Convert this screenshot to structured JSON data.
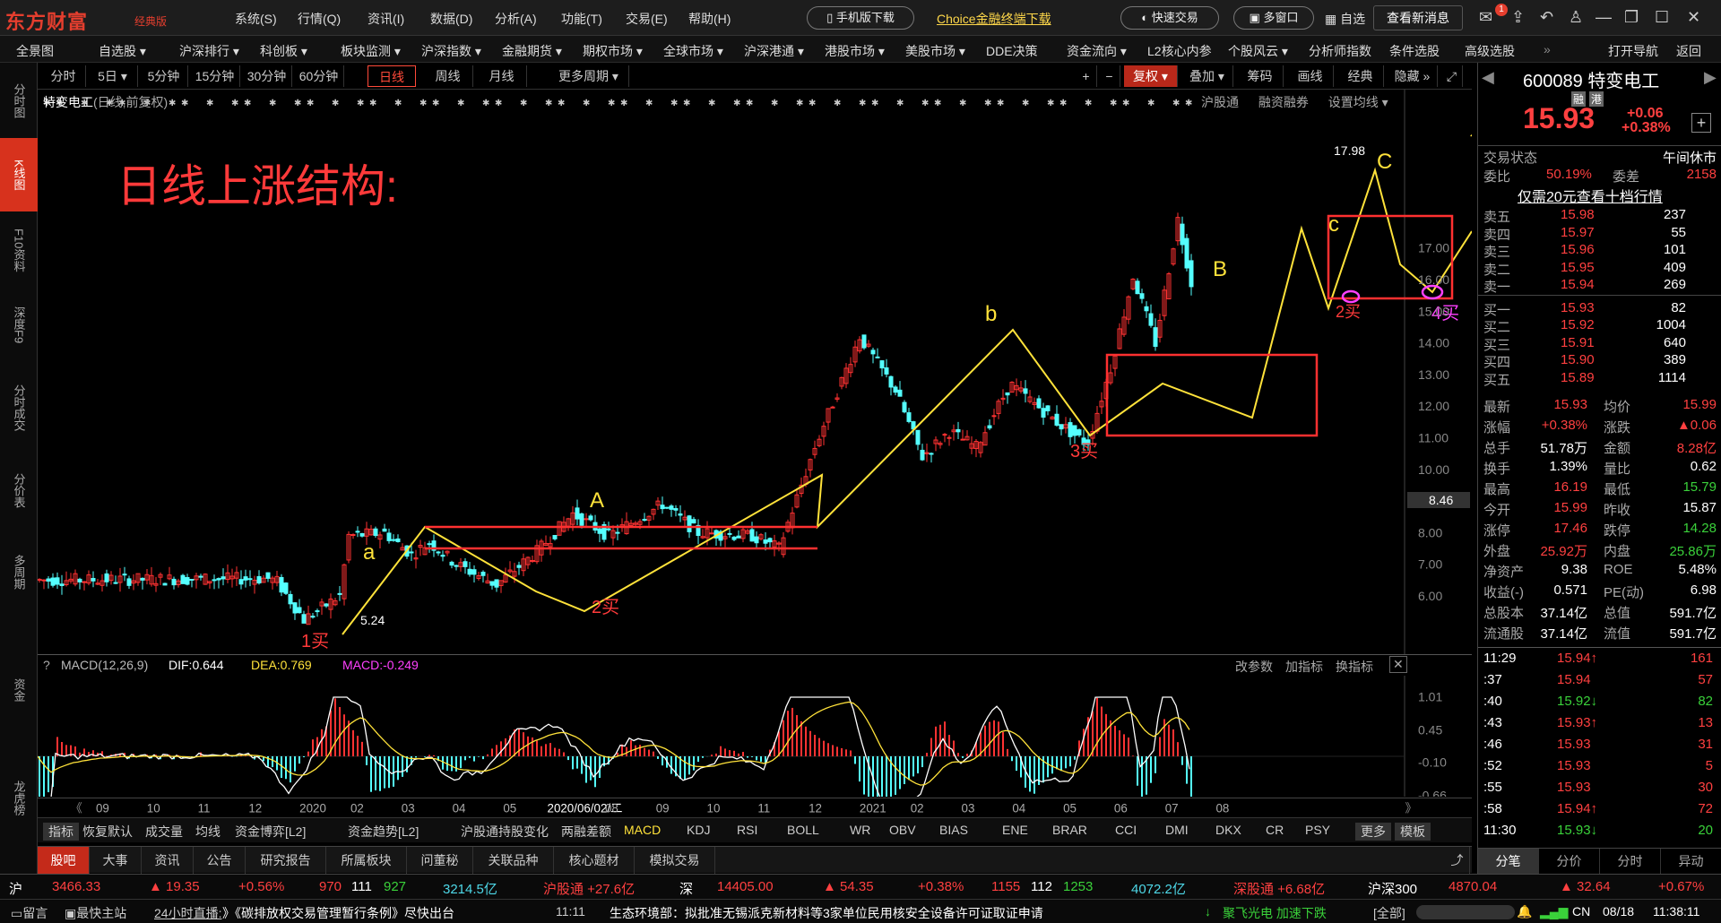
{
  "app": {
    "logo": "东方财富",
    "edition": "经典版"
  },
  "menu": [
    "系统(S)",
    "行情(Q)",
    "资讯(I)",
    "数据(D)",
    "分析(A)",
    "功能(T)",
    "交易(E)",
    "帮助(H)"
  ],
  "top_actions": {
    "mobile": "手机版下载",
    "choice": "Choice金融终端下载",
    "quick_trade": "快速交易",
    "multi_window": "多窗口",
    "self": "自选",
    "new_msg": "查看新消息",
    "msg_count": "1"
  },
  "nav": [
    "全景图",
    "自选股 ▾",
    "沪深排行 ▾",
    "科创板 ▾",
    "板块监测 ▾",
    "沪深指数 ▾",
    "金融期货 ▾",
    "期权市场 ▾",
    "全球市场 ▾",
    "沪深港通 ▾",
    "港股市场 ▾",
    "美股市场 ▾",
    "DDE决策",
    "资金流向 ▾",
    "L2核心内参",
    "个股风云 ▾",
    "分析师指数",
    "条件选股",
    "高级选股"
  ],
  "nav_right": {
    "more": "»",
    "open_nav": "打开导航",
    "back": "返回"
  },
  "sidebar": [
    "分时图",
    "K线图",
    "F10资料",
    "深度F9",
    "分时成交",
    "分价表",
    "多周期",
    "资金",
    "龙虎榜"
  ],
  "periods": [
    "分时",
    "5日 ▾",
    "5分钟",
    "15分钟",
    "30分钟",
    "60分钟",
    "日线",
    "周线",
    "月线",
    "更多周期 ▾"
  ],
  "toolbar_right": [
    "+",
    "−",
    "复权 ▾",
    "叠加 ▾",
    "筹码",
    "画线",
    "经典",
    "隐藏 »"
  ],
  "chart": {
    "stock_title": "特变电工",
    "mode": "(日线,前复权)",
    "right_links": [
      "沪股通",
      "融资融券",
      "设置均线 ▾"
    ],
    "annotation_title": "日线上涨结构:",
    "y_ticks": [
      "17.00",
      "16.00",
      "15.00",
      "14.00",
      "13.00",
      "12.00",
      "11.00",
      "10.00",
      "9.00",
      "8.00",
      "7.00",
      "6.00"
    ],
    "current_marker": "8.46",
    "high_label": "17.98",
    "low_label": "5.24",
    "labels": {
      "a": "a",
      "A": "A",
      "b": "b",
      "B": "B",
      "c": "c",
      "C": "C",
      "d": "d",
      "buy1": "1买",
      "buy2": "2买",
      "buy3": "3买",
      "buy2b": "2买",
      "buy4": "4买"
    }
  },
  "macd": {
    "label": "MACD(12,26,9)",
    "dif": "DIF:0.644",
    "dea": "DEA:0.769",
    "macd": "MACD:-0.249",
    "links": [
      "改参数",
      "加指标",
      "换指标"
    ],
    "y_ticks": [
      "1.01",
      "0.45",
      "-0.10",
      "-0.66"
    ]
  },
  "x_axis": [
    "09",
    "10",
    "11",
    "12",
    "2020",
    "02",
    "03",
    "04",
    "05",
    "2020/06/02/二",
    "08",
    "09",
    "10",
    "11",
    "12",
    "2021",
    "02",
    "03",
    "04",
    "05",
    "06",
    "07",
    "08"
  ],
  "indicators": [
    "指标",
    "恢复默认",
    "成交量",
    "均线",
    "资金博弈[L2]",
    "资金趋势[L2]",
    "沪股通持股变化",
    "两融差额",
    "MACD",
    "KDJ",
    "RSI",
    "BOLL",
    "WR",
    "OBV",
    "BIAS",
    "ENE",
    "BRAR",
    "CCI",
    "DMI",
    "DKX",
    "CR",
    "PSY",
    "更多",
    "模板"
  ],
  "info_tabs": [
    "股吧",
    "大事",
    "资讯",
    "公告",
    "研究报告",
    "所属板块",
    "问董秘",
    "关联品种",
    "核心题材",
    "模拟交易"
  ],
  "quote": {
    "code": "600089",
    "name": "特变电工",
    "tags": [
      "融",
      "港"
    ],
    "price": "15.93",
    "change": "+0.06",
    "pct": "+0.38%",
    "status_label": "交易状态",
    "status": "午间休市",
    "ratio_label": "委比",
    "ratio": "50.19%",
    "diff_label": "委差",
    "diff": "2158",
    "promo": "仅需20元查看十档行情",
    "asks": [
      {
        "l": "卖五",
        "p": "15.98",
        "v": "237"
      },
      {
        "l": "卖四",
        "p": "15.97",
        "v": "55"
      },
      {
        "l": "卖三",
        "p": "15.96",
        "v": "101"
      },
      {
        "l": "卖二",
        "p": "15.95",
        "v": "409"
      },
      {
        "l": "卖一",
        "p": "15.94",
        "v": "269"
      }
    ],
    "bids": [
      {
        "l": "买一",
        "p": "15.93",
        "v": "82"
      },
      {
        "l": "买二",
        "p": "15.92",
        "v": "1004"
      },
      {
        "l": "买三",
        "p": "15.91",
        "v": "640"
      },
      {
        "l": "买四",
        "p": "15.90",
        "v": "389"
      },
      {
        "l": "买五",
        "p": "15.89",
        "v": "1114"
      }
    ],
    "stats": [
      [
        "最新",
        "15.93",
        "均价",
        "15.99"
      ],
      [
        "涨幅",
        "+0.38%",
        "涨跌",
        "▲0.06"
      ],
      [
        "总手",
        "51.78万",
        "金额",
        "8.28亿"
      ],
      [
        "换手",
        "1.39%",
        "量比",
        "0.62"
      ],
      [
        "最高",
        "16.19",
        "最低",
        "15.79"
      ],
      [
        "今开",
        "15.99",
        "昨收",
        "15.87"
      ],
      [
        "涨停",
        "17.46",
        "跌停",
        "14.28"
      ],
      [
        "外盘",
        "25.92万",
        "内盘",
        "25.86万"
      ],
      [
        "净资产",
        "9.38",
        "ROE",
        "5.48%"
      ],
      [
        "收益(-)",
        "0.571",
        "PE(动)",
        "6.98"
      ],
      [
        "总股本",
        "37.14亿",
        "总值",
        "591.7亿"
      ],
      [
        "流通股",
        "37.14亿",
        "流值",
        "591.7亿"
      ]
    ],
    "ticks": [
      [
        "11:29",
        "15.94↑",
        "161"
      ],
      [
        ":37",
        "15.94",
        "57"
      ],
      [
        ":40",
        "15.92↓",
        "82"
      ],
      [
        ":43",
        "15.93↑",
        "13"
      ],
      [
        ":46",
        "15.93",
        "31"
      ],
      [
        ":52",
        "15.93",
        "5"
      ],
      [
        ":55",
        "15.93",
        "30"
      ],
      [
        ":58",
        "15.94↑",
        "72"
      ],
      [
        "11:30",
        "15.93↓",
        "20"
      ]
    ],
    "bottom_tabs": [
      "分笔",
      "分价",
      "分时",
      "异动"
    ]
  },
  "status": {
    "sh": "沪",
    "sh_idx": "3466.33",
    "sh_chg": "▲ 19.35",
    "sh_pct": "+0.56%",
    "sh_up": "970",
    "sh_flat": "111",
    "sh_down": "927",
    "sh_amt": "3214.5亿",
    "hgt": "沪股通 +27.6亿",
    "sz": "深",
    "sz_idx": "14405.00",
    "sz_chg": "▲ 54.35",
    "sz_pct": "+0.38%",
    "sz_up": "1155",
    "sz_flat": "112",
    "sz_down": "1253",
    "sz_amt": "4072.2亿",
    "sgt": "深股通 +6.68亿",
    "hs300": "沪深300",
    "hs_idx": "4870.04",
    "hs_chg": "▲ 32.64",
    "hs_pct": "+0.67%"
  },
  "news": {
    "msg": "留言",
    "client": "最快主站",
    "live": "24小时直播:",
    "n1": "》《碳排放权交易管理暂行条例》尽快出台",
    "time": "11:11",
    "n2": "生态环境部：拟批准无锡派克新材料等3家单位民用核安全设备许可证取证申请",
    "alert": "聚飞光电 加速下跌",
    "all": "[全部]",
    "lang": "CN",
    "date": "08/18",
    "clock": "11:38:11"
  }
}
